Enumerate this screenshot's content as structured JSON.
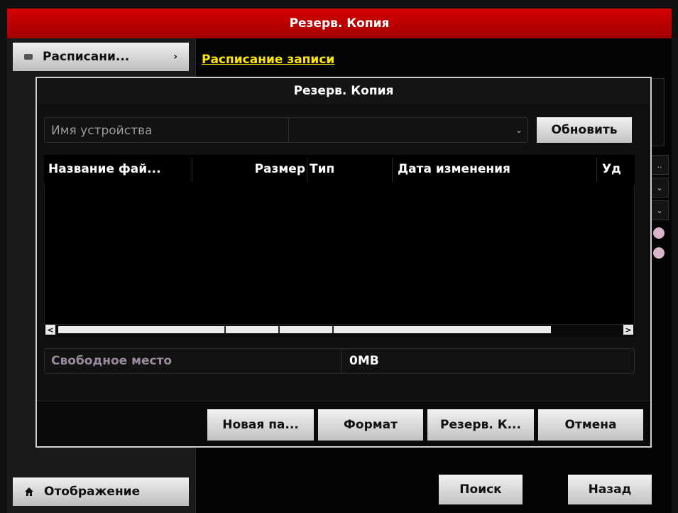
{
  "window": {
    "title": "Резерв. Копия"
  },
  "sidebar": {
    "items": [
      {
        "label": "Расписани...",
        "icon": "folder-icon"
      },
      {
        "label": "Отображение",
        "icon": "home-icon"
      }
    ]
  },
  "main": {
    "link": "Расписание записи"
  },
  "bottom_buttons": {
    "search": "Поиск",
    "back": "Назад"
  },
  "dialog": {
    "title": "Резерв. Копия",
    "device": {
      "label": "Имя устройства",
      "value": "",
      "refresh": "Обновить"
    },
    "table": {
      "columns": [
        "Название фай...",
        "Размер",
        "Тип",
        "Дата изменения",
        "Уд"
      ],
      "rows": []
    },
    "free_space": {
      "label": "Свободное место",
      "value": "0MB"
    },
    "buttons": {
      "new_folder": "Новая па...",
      "format": "Формат",
      "backup": "Резерв. К...",
      "cancel": "Отмена"
    }
  },
  "colors": {
    "title_bar": "#c00000",
    "link": "#ffe800",
    "dialog_border": "#cfcfcf"
  }
}
